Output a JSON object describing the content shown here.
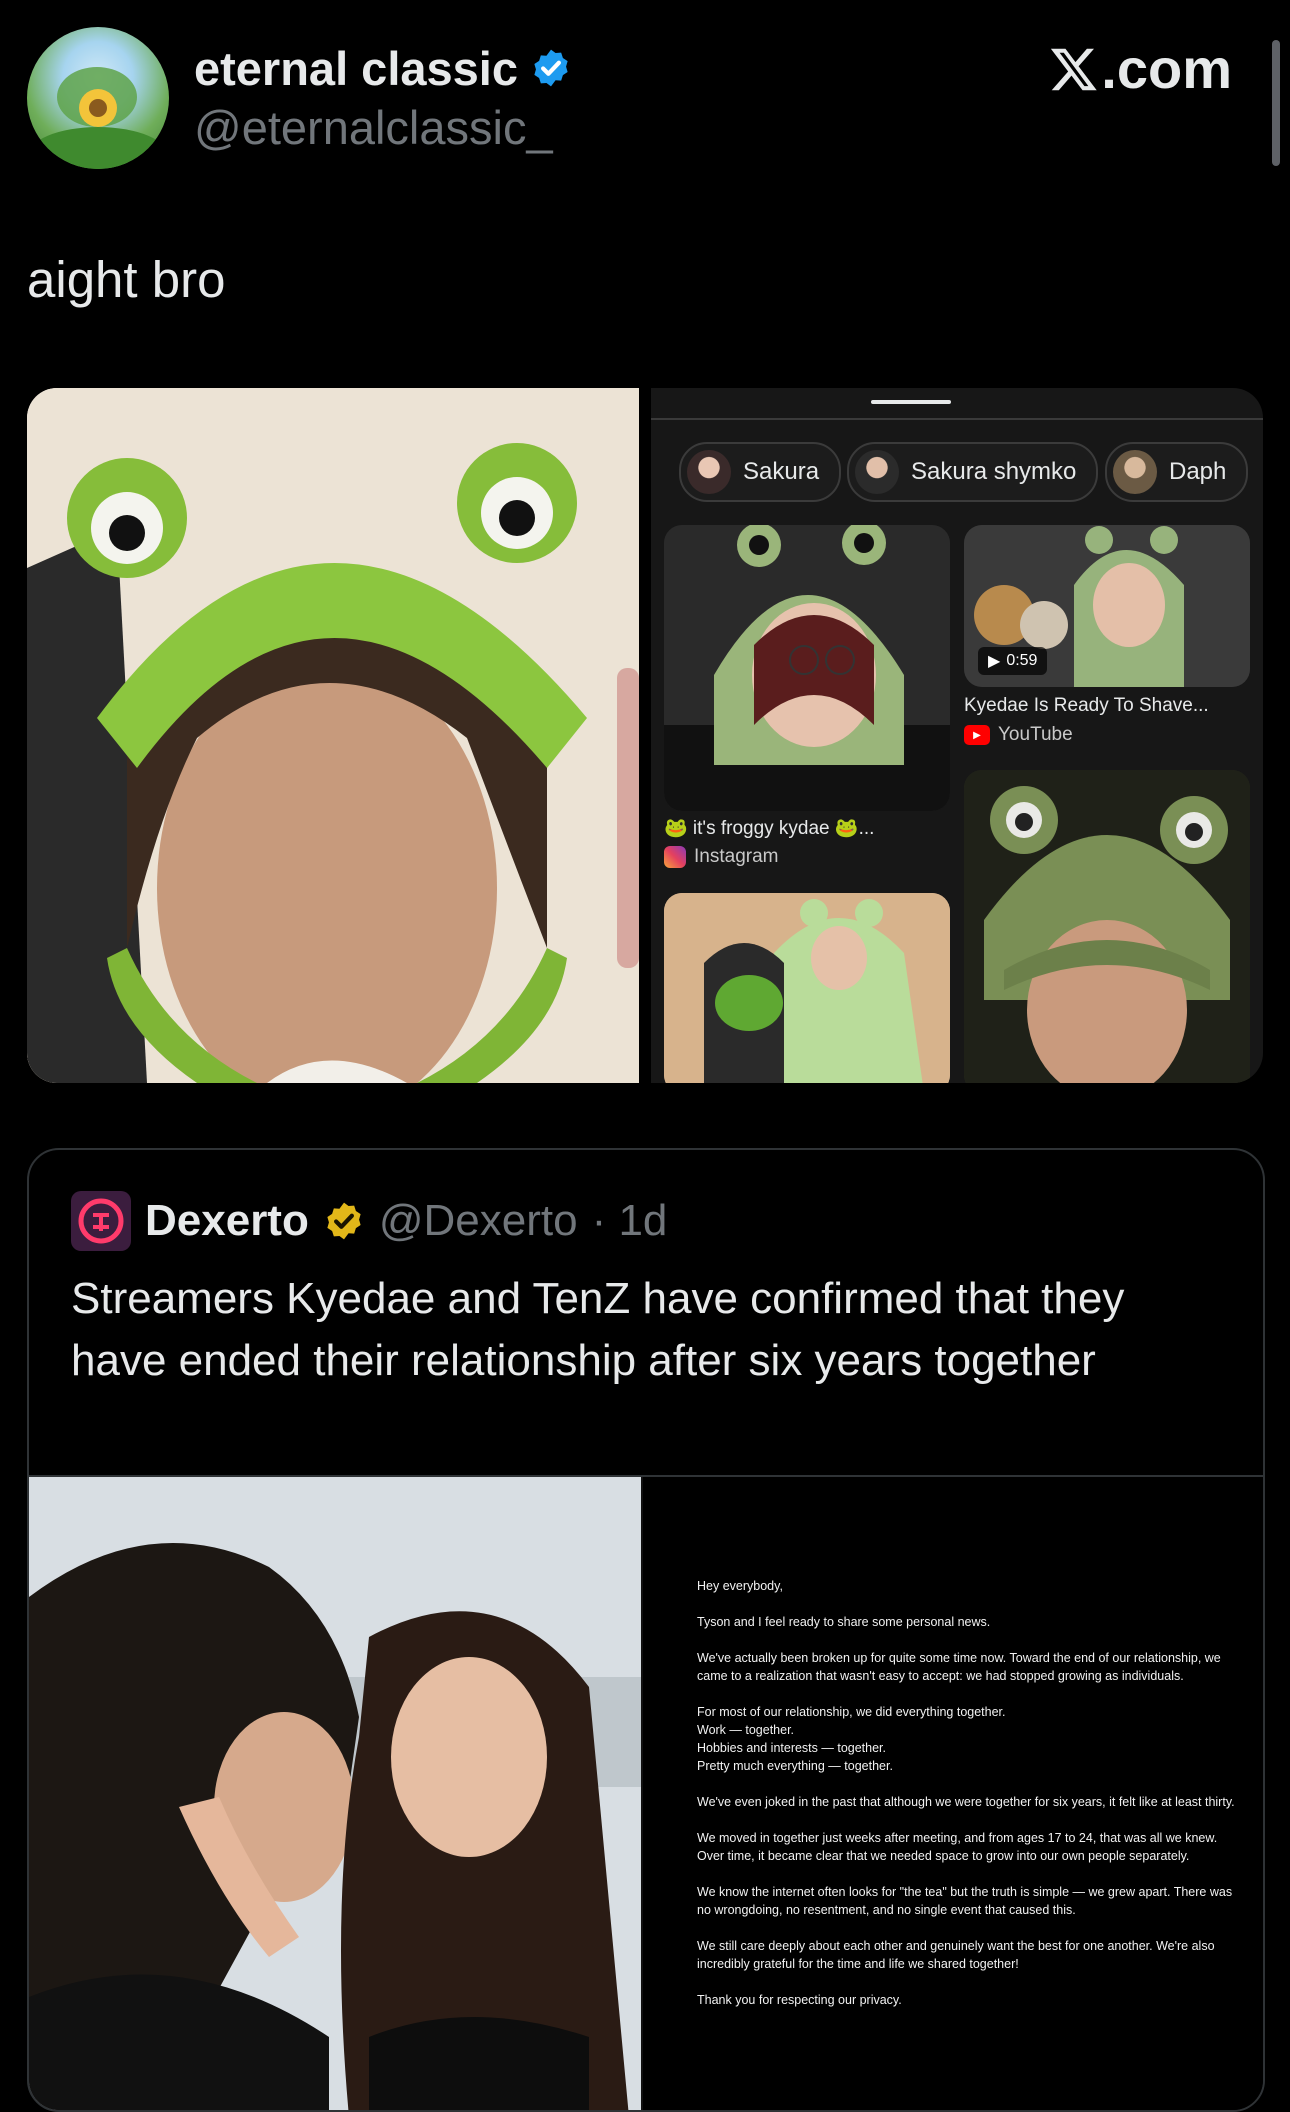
{
  "author": {
    "display_name": "eternal classic",
    "handle": "@eternalclassic_",
    "verified_icon": "verified-badge-blue-icon"
  },
  "site": {
    "label": ".com",
    "logo_icon": "x-logo-icon"
  },
  "tweet": {
    "text": "aight bro"
  },
  "search_screenshot": {
    "chips": [
      "Sakura",
      "Sakura shymko",
      "Daph"
    ],
    "results": [
      {
        "title": "🐸 it's froggy kydae 🐸...",
        "source": "Instagram",
        "source_icon": "instagram-icon"
      },
      {
        "title": "Kyedae Is Ready To Shave...",
        "source": "YouTube",
        "source_icon": "youtube-icon",
        "duration": "0:59"
      }
    ]
  },
  "quote": {
    "name": "Dexerto",
    "handle": "@Dexerto",
    "time": "· 1d",
    "badge_icon": "verified-badge-gold-icon",
    "text": "Streamers Kyedae and TenZ have confirmed that they have ended their relationship after six years together",
    "letter": "Hey everybody,\n\nTyson and I feel ready to share some personal news.\n\nWe've actually been broken up for quite some time now. Toward the end of our relationship, we came to a realization that wasn't easy to accept: we had stopped growing as individuals.\n\nFor most of our relationship, we did everything together.\nWork — together.\nHobbies and interests — together.\nPretty much everything — together.\n\nWe've even joked in the past that although we were together for six years, it felt like at least thirty.\n\nWe moved in together just weeks after meeting, and from ages 17 to 24, that was all we knew. Over time, it became clear that we needed space to grow into our own people separately.\n\nWe know the internet often looks for \"the tea\" but the truth is simple — we grew apart. There was no wrongdoing, no resentment, and no single event that caused this.\n\nWe still care deeply about each other and genuinely want the best for one another. We're also incredibly grateful for the time and life we shared together!\n\nThank you for respecting our privacy."
  },
  "colors": {
    "background": "#000000",
    "text_primary": "#e7e9ea",
    "text_secondary": "#71767b",
    "verified_blue": "#1d9bf0",
    "verified_gold": "#e2b719",
    "border": "#2f3336"
  }
}
